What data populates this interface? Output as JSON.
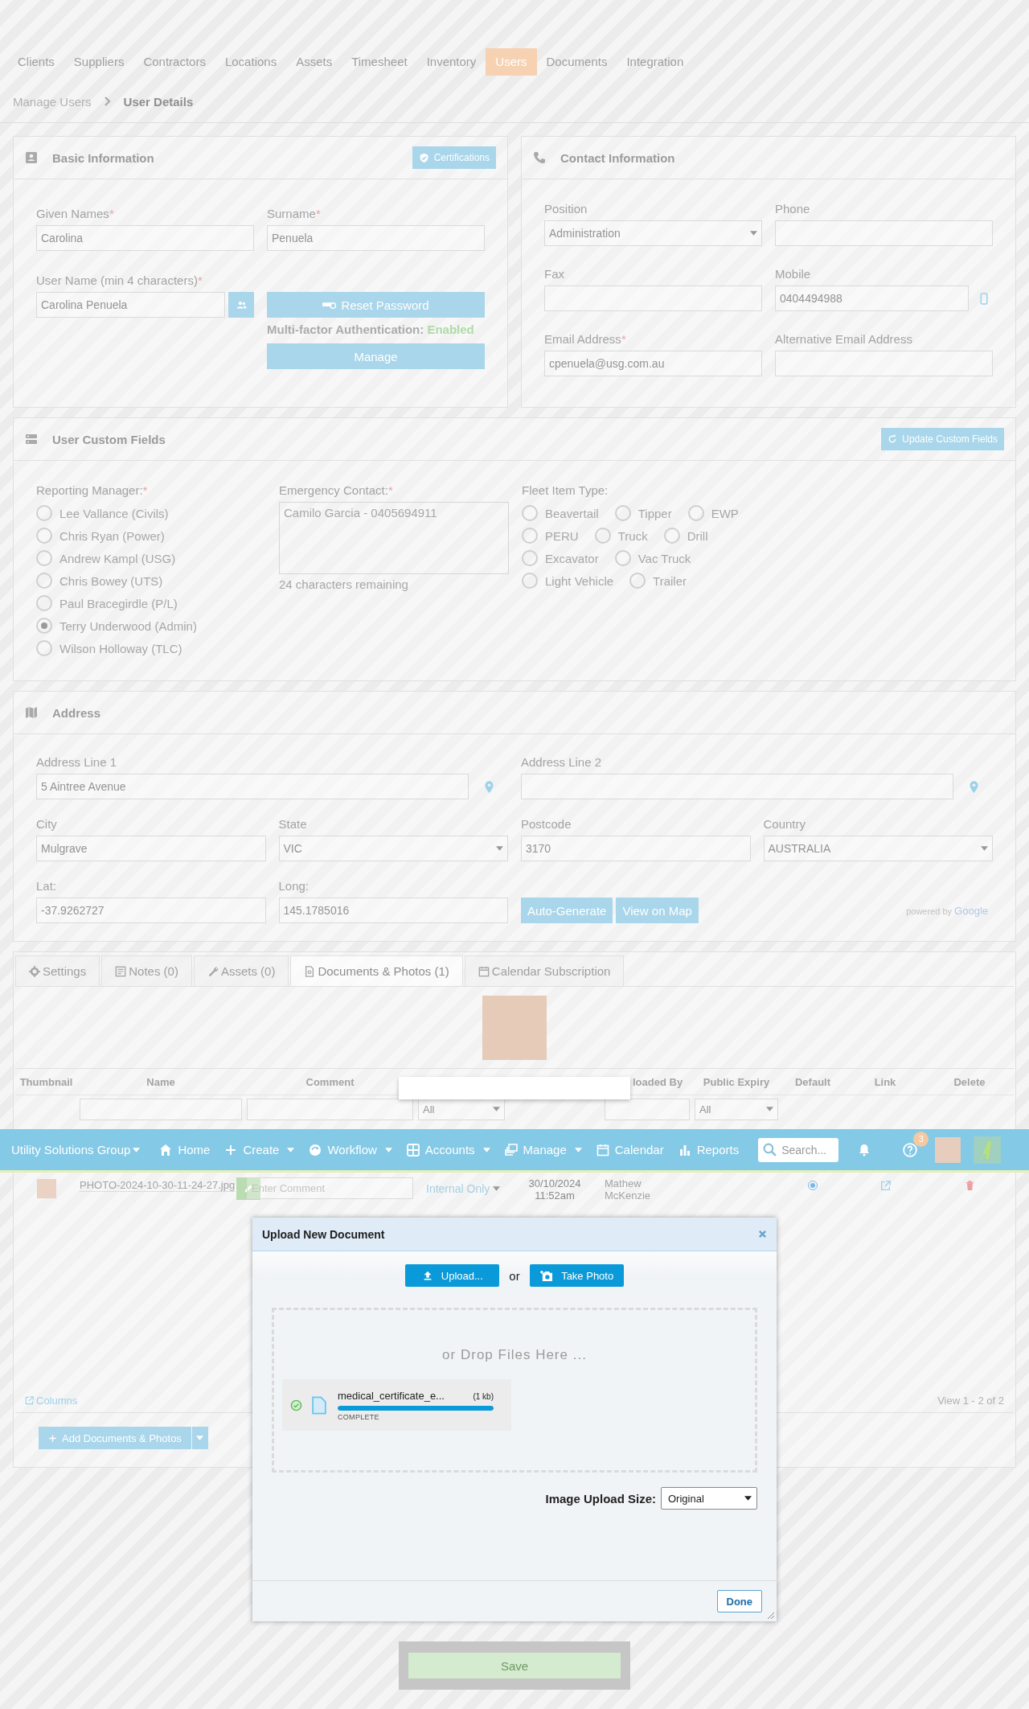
{
  "top_nav": [
    {
      "label": "Clients",
      "selected": false
    },
    {
      "label": "Suppliers",
      "selected": false
    },
    {
      "label": "Contractors",
      "selected": false
    },
    {
      "label": "Locations",
      "selected": false
    },
    {
      "label": "Assets",
      "selected": false
    },
    {
      "label": "Timesheet",
      "selected": false
    },
    {
      "label": "Inventory",
      "selected": false
    },
    {
      "label": "Users",
      "selected": true
    },
    {
      "label": "Documents",
      "selected": false
    },
    {
      "label": "Integration",
      "selected": false
    }
  ],
  "breadcrumb": [
    {
      "label": "Manage Users"
    },
    {
      "label": "User Details"
    }
  ],
  "basic_information": {
    "title": "Basic Information",
    "certifications_button": "Certifications",
    "given_names": {
      "label": "Given Names",
      "mark": "*",
      "value": "Carolina"
    },
    "surname": {
      "label": "Surname",
      "mark": "*",
      "value": "Penuela"
    },
    "user_name": {
      "label": "User Name (min 4 characters)",
      "mark": "*",
      "value": "Carolina Penuela"
    },
    "reset_password_button": "Reset Password",
    "mfa": {
      "label": "Multi-factor Authentication:",
      "status": "Enabled",
      "enabled": true
    },
    "manage_button": "Manage"
  },
  "contact_information": {
    "title": "Contact Information",
    "fields": [
      {
        "label": "Position",
        "kind": "select",
        "value": "Administration"
      },
      {
        "label": "Phone",
        "kind": "text"
      },
      {
        "label": "Fax",
        "kind": "text"
      },
      {
        "label": "Mobile",
        "kind": "phone",
        "value": "0404494988"
      },
      {
        "label": "Email Address",
        "mark": "*",
        "kind": "text",
        "value": "cpenuela@usg.com.au"
      },
      {
        "label": "Alternative Email Address",
        "kind": "text"
      }
    ]
  },
  "user_custom_fields": {
    "title": "User Custom Fields",
    "update_button": "Update Custom Fields",
    "reporting_manager": {
      "label": "Reporting Manager:",
      "mark": "*",
      "options": [
        {
          "label": "Lee Vallance (Civils)",
          "selected": false
        },
        {
          "label": "Chris Ryan (Power)",
          "selected": false
        },
        {
          "label": "Andrew Kampl (USG)",
          "selected": false
        },
        {
          "label": "Chris Bowey (UTS)",
          "selected": false
        },
        {
          "label": "Paul Bracegirdle (P/L)",
          "selected": false
        },
        {
          "label": "Terry Underwood (Admin)",
          "selected": true
        },
        {
          "label": "Wilson Holloway (TLC)",
          "selected": false
        }
      ]
    },
    "emergency_contact": {
      "label": "Emergency Contact:",
      "mark": "*",
      "value": "Camilo Garcia - 0405694911",
      "hint": "24 characters remaining"
    },
    "fleet_item_type": {
      "label": "Fleet Item Type:",
      "rows": [
        [
          {
            "label": "Beavertail",
            "selected": false
          },
          {
            "label": "Tipper",
            "selected": false
          },
          {
            "label": "EWP",
            "selected": false
          }
        ],
        [
          {
            "label": "PERU",
            "selected": false
          },
          {
            "label": "Truck",
            "selected": false
          },
          {
            "label": "Drill",
            "selected": false
          }
        ],
        [
          {
            "label": "Excavator",
            "selected": false
          },
          {
            "label": "Vac Truck",
            "selected": false
          }
        ],
        [
          {
            "label": "Light Vehicle",
            "selected": false
          },
          {
            "label": "Trailer",
            "selected": false
          }
        ]
      ]
    }
  },
  "address": {
    "title": "Address",
    "fields": [
      {
        "label": "Address Line 1",
        "kind": "location",
        "value": "5 Aintree Avenue"
      },
      {
        "label": "Address Line 2",
        "kind": "location"
      },
      {
        "label": "City",
        "kind": "text",
        "value": "Mulgrave"
      },
      {
        "label": "State",
        "kind": "select",
        "value": "VIC"
      },
      {
        "label": "Postcode",
        "kind": "text",
        "value": "3170"
      },
      {
        "label": "Country",
        "kind": "select",
        "value": "AUSTRALIA"
      },
      {
        "label": "Lat:",
        "kind": "text",
        "value": "-37.9262727"
      },
      {
        "label": "Long:",
        "kind": "text",
        "value": "145.1785016"
      }
    ],
    "buttons": [
      "Auto-Generate",
      "View on Map"
    ],
    "attribution": {
      "prefix": "powered by",
      "brand": "Google"
    }
  },
  "detail_tabs": [
    {
      "label": "Settings",
      "kind": "gear",
      "selected": false
    },
    {
      "label": "Notes (0)",
      "kind": "note",
      "selected": false
    },
    {
      "label": "Assets (0)",
      "kind": "wrench",
      "selected": false
    },
    {
      "label": "Documents & Photos (1)",
      "kind": "document",
      "selected": true
    },
    {
      "label": "Calendar Subscription",
      "kind": "calendar",
      "selected": false
    }
  ],
  "documents_table": {
    "columns": [
      "Thumbnail",
      "Name",
      "Comment",
      "loaded By",
      "Public Expiry",
      "Default",
      "Link",
      "Delete"
    ],
    "filters": [
      {
        "kind": "text"
      },
      {
        "kind": "text"
      },
      {
        "kind": "select",
        "value": "All"
      },
      {
        "kind": "text"
      },
      {
        "kind": "select",
        "value": "All"
      }
    ],
    "rows": [
      {
        "name": "PHOTO-2024-10-30-11-24-27.jpg",
        "comment_placeholder": "Enter Comment",
        "visibility": "Internal Only",
        "date": "30/10/2024",
        "time": "11:52am",
        "uploaded_by": "Mathew McKenzie",
        "default": true
      }
    ],
    "columns_link": "Columns",
    "pager": "View 1 - 2 of 2"
  },
  "add_button": "Add Documents & Photos",
  "main_nav": {
    "org": "Utility Solutions Group",
    "items": [
      {
        "label": "Home",
        "kind": "home",
        "dropdown": false
      },
      {
        "label": "Create",
        "kind": "plus",
        "dropdown": true
      },
      {
        "label": "Workflow",
        "kind": "workflow",
        "dropdown": true
      },
      {
        "label": "Accounts",
        "kind": "accounts",
        "dropdown": true
      },
      {
        "label": "Manage",
        "kind": "manage",
        "dropdown": true
      },
      {
        "label": "Calendar",
        "kind": "calendar",
        "dropdown": false
      },
      {
        "label": "Reports",
        "kind": "chart",
        "dropdown": false
      }
    ],
    "search": {
      "placeholder": "Search..."
    },
    "notifications_badge": "3"
  },
  "upload_dialog": {
    "title": "Upload New Document",
    "upload_button": "Upload...",
    "separator": "or",
    "photo_button": "Take Photo",
    "drop_hint": "or Drop Files Here ...",
    "file": {
      "name": "medical_certificate_e...",
      "size": "(1 kb)",
      "status": "COMPLETE",
      "level": 1,
      "done": true
    },
    "image_upload_size": {
      "label": "Image Upload Size:",
      "value": "Original"
    },
    "done_button": "Done"
  },
  "save_button": "Save"
}
